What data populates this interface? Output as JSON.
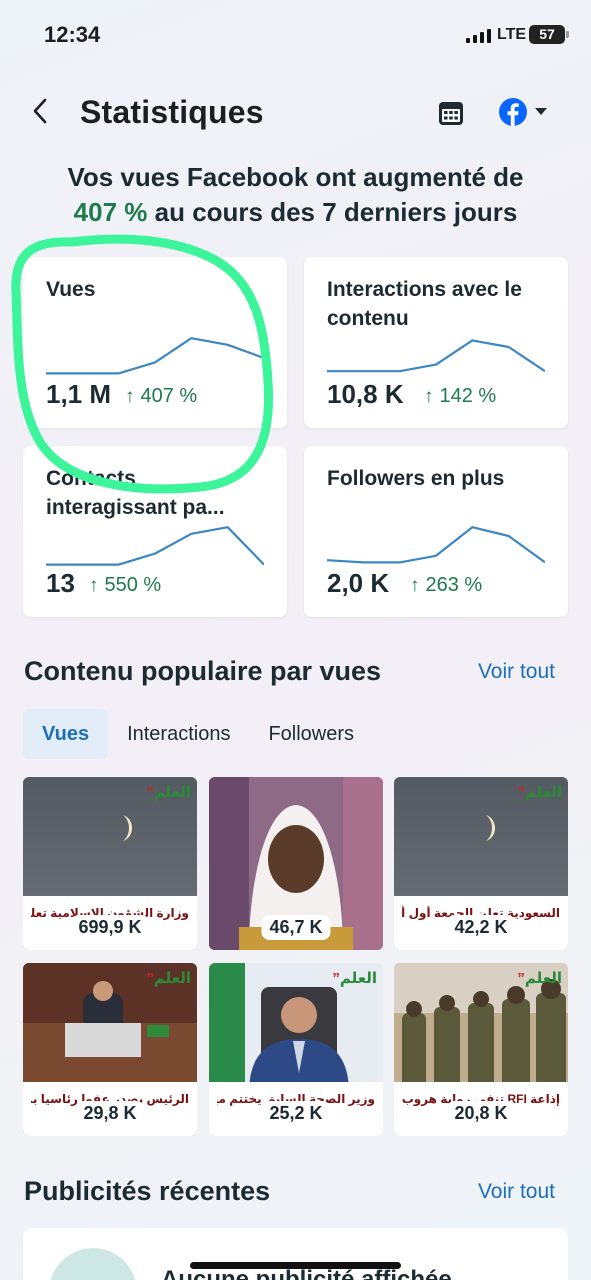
{
  "status": {
    "time": "12:34",
    "network": "LTE",
    "battery": "57"
  },
  "header": {
    "back_icon": "chevron-left-icon",
    "title": "Statistiques",
    "calendar_icon": "calendar-icon",
    "account_icon": "facebook-icon"
  },
  "headline": {
    "prefix": "Vos vues Facebook ont augmenté de",
    "percent": "407 %",
    "suffix": "au cours des 7 derniers jours"
  },
  "stats": [
    {
      "label": "Vues",
      "value": "1,1 M",
      "delta": "407 %",
      "spark": [
        0.15,
        0.15,
        0.15,
        0.4,
        0.95,
        0.8,
        0.5
      ]
    },
    {
      "label": "Interactions avec le contenu",
      "value": "10,8 K",
      "delta": "142 %",
      "spark": [
        0.2,
        0.2,
        0.2,
        0.35,
        0.9,
        0.75,
        0.2
      ]
    },
    {
      "label": "Contacts interagissant pa...",
      "value": "13",
      "delta": "550 %",
      "spark": [
        0.1,
        0.1,
        0.1,
        0.35,
        0.8,
        0.95,
        0.1
      ]
    },
    {
      "label": "Followers en plus",
      "value": "2,0 K",
      "delta": "263 %",
      "spark": [
        0.2,
        0.15,
        0.15,
        0.3,
        0.95,
        0.75,
        0.15
      ]
    }
  ],
  "popular": {
    "title": "Contenu populaire par vues",
    "see_all": "Voir tout",
    "tabs": [
      "Vues",
      "Interactions",
      "Followers"
    ],
    "items": [
      {
        "caption": "وزارة الشؤون الإسلامية تعلن تحري هلال",
        "count": "699,9 K"
      },
      {
        "caption": "",
        "count": "46,7 K"
      },
      {
        "caption": "السعودية تعلن الجمعة أول أيام",
        "count": "42,2 K"
      },
      {
        "caption": "الرئيس يصدر عفوا رئاسيا بمناسبة عيد",
        "count": "29,8 K"
      },
      {
        "caption": "وزير الصحة السابق يختتم مهامه برسالة",
        "count": "25,2 K"
      },
      {
        "caption": "إذاعة RFI تنفي رواية هروب",
        "count": "20,8 K"
      }
    ],
    "logo_text": "العلم"
  },
  "ads": {
    "title": "Publicités récentes",
    "see_all": "Voir tout",
    "first_item": "Aucune publicité affichée"
  },
  "colors": {
    "accent_green": "#1f7a4e",
    "link_blue": "#1d6fb8",
    "highlight": "#3cf49a"
  }
}
